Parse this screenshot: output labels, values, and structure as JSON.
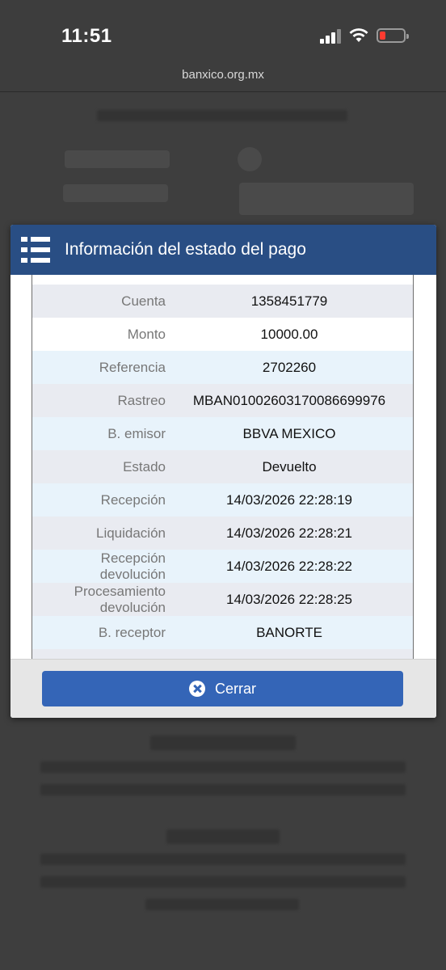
{
  "status_bar": {
    "time": "11:51"
  },
  "browser": {
    "url": "banxico.org.mx"
  },
  "modal": {
    "title": "Información del estado del pago",
    "rows": [
      {
        "label": "Cuenta",
        "value": "1358451779"
      },
      {
        "label": "Monto",
        "value": "10000.00"
      },
      {
        "label": "Referencia",
        "value": "2702260"
      },
      {
        "label": "Rastreo",
        "value": "MBAN01002603170086699976"
      },
      {
        "label": "B. emisor",
        "value": "BBVA MEXICO"
      },
      {
        "label": "Estado",
        "value": "Devuelto"
      },
      {
        "label": "Recepción",
        "value": "14/03/2026 22:28:19"
      },
      {
        "label": "Liquidación",
        "value": "14/03/2026 22:28:21"
      },
      {
        "label": "Recepción devolución",
        "value": "14/03/2026 22:28:22"
      },
      {
        "label": "Procesamiento devolución",
        "value": "14/03/2026 22:28:25"
      },
      {
        "label": "B. receptor",
        "value": "BANORTE"
      }
    ],
    "close_label": "Cerrar"
  },
  "colors": {
    "header": "#294e84",
    "button": "#3465b7",
    "battery_low": "#ff3b30"
  }
}
